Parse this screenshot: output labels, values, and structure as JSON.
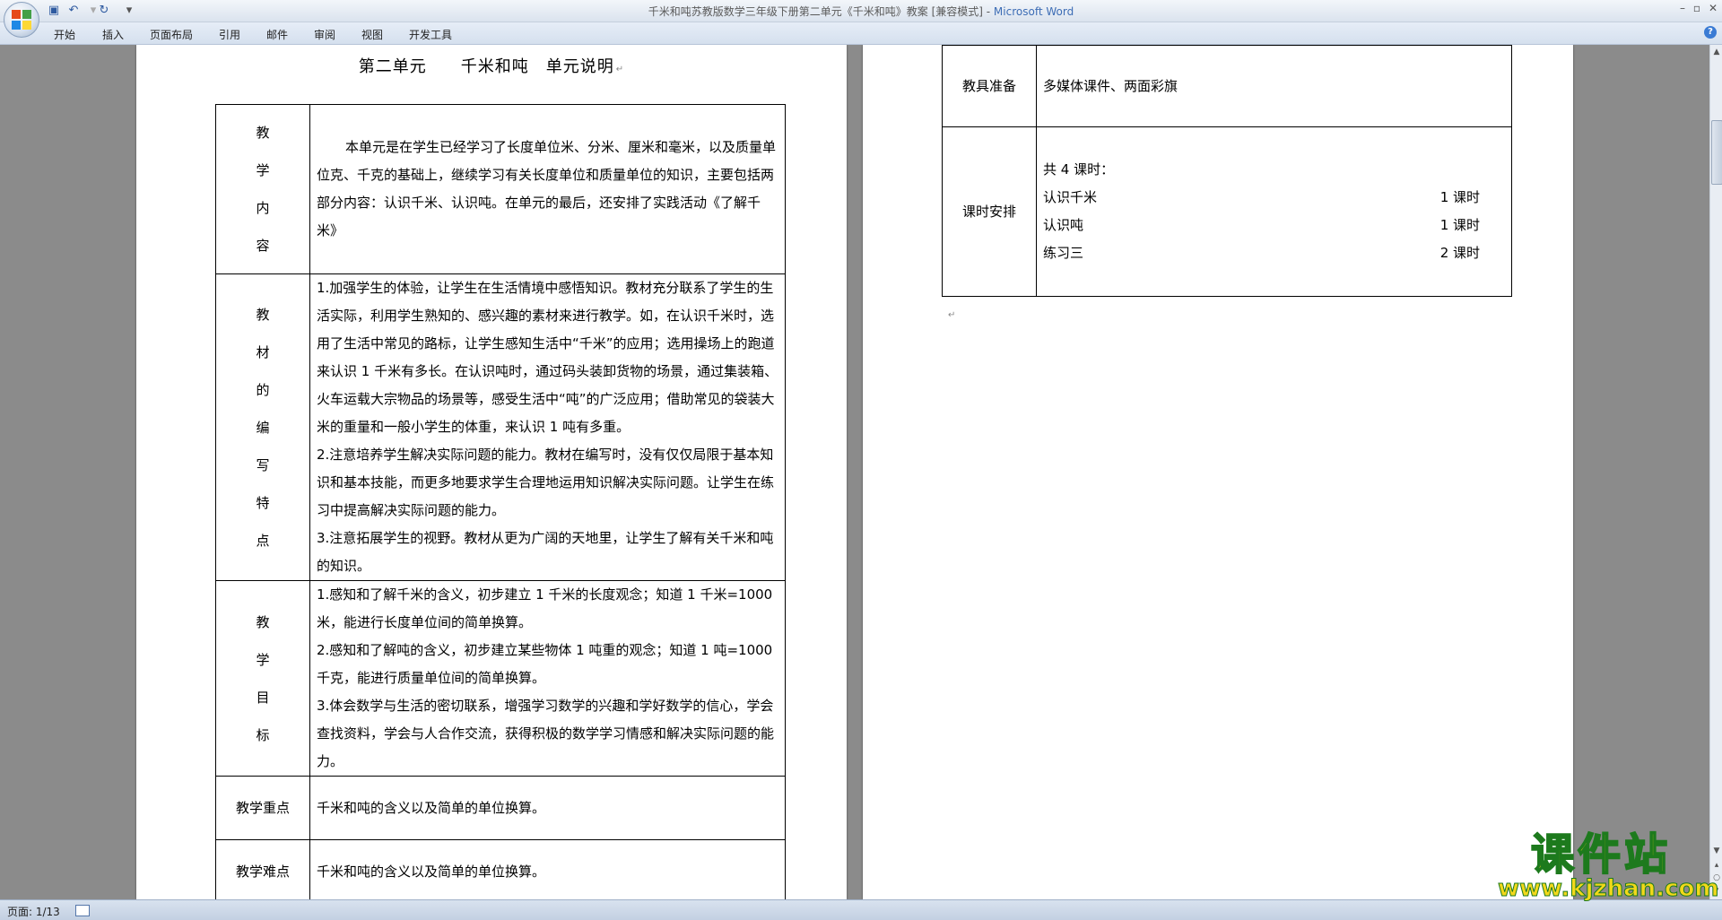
{
  "window": {
    "title": "千米和吨苏教版数学三年级下册第二单元《千米和吨》教案 [兼容模式] - ",
    "app_name": "Microsoft Word"
  },
  "quick_access": {
    "save_icon": "save-icon",
    "undo_icon": "undo-icon",
    "redo_icon": "redo-icon",
    "dropdown": "▾"
  },
  "ribbon": {
    "tabs": [
      "开始",
      "插入",
      "页面布局",
      "引用",
      "邮件",
      "审阅",
      "视图",
      "开发工具"
    ]
  },
  "page1": {
    "title": "第二单元　　千米和吨　单元说明",
    "rows": {
      "content_label": [
        "教",
        "学",
        "内",
        "容"
      ],
      "content_text": "本单元是在学生已经学习了长度单位米、分米、厘米和毫米，以及质量单位克、千克的基础上，继续学习有关长度单位和质量单位的知识，主要包括两部分内容：认识千米、认识吨。在单元的最后，还安排了实践活动《了解千米》",
      "features_label": [
        "教",
        "材",
        "的",
        "编",
        "写",
        "特",
        "点"
      ],
      "features_text": [
        "1.加强学生的体验，让学生在生活情境中感悟知识。教材充分联系了学生的生活实际，利用学生熟知的、感兴趣的素材来进行教学。如，在认识千米时，选用了生活中常见的路标，让学生感知生活中“千米”的应用；选用操场上的跑道来认识 1 千米有多长。在认识吨时，通过码头装卸货物的场景，通过集装箱、火车运载大宗物品的场景等，感受生活中“吨”的广泛应用；借助常见的袋装大米的重量和一般小学生的体重，来认识 1 吨有多重。",
        "2.注意培养学生解决实际问题的能力。教材在编写时，没有仅仅局限于基本知识和基本技能，而更多地要求学生合理地运用知识解决实际问题。让学生在练习中提高解决实际问题的能力。",
        "3.注意拓展学生的视野。教材从更为广阔的天地里，让学生了解有关千米和吨的知识。"
      ],
      "goals_label": [
        "教",
        "学",
        "目",
        "标"
      ],
      "goals_text": [
        "1.感知和了解千米的含义，初步建立 1 千米的长度观念；知道 1 千米=1000 米，能进行长度单位间的简单换算。",
        "2.感知和了解吨的含义，初步建立某些物体 1 吨重的观念；知道 1 吨=1000 千克，能进行质量单位间的简单换算。",
        "3.体会数学与生活的密切联系，增强学习数学的兴趣和学好数学的信心，学会查找资料，学会与人合作交流，获得积极的数学学习情感和解决实际问题的能力。"
      ],
      "key_label": "教学重点",
      "key_text": "千米和吨的含义以及简单的单位换算。",
      "difficulty_label": "教学难点",
      "difficulty_text": "千米和吨的含义以及简单的单位换算。"
    }
  },
  "page2": {
    "prep_label": "教具准备",
    "prep_text": "多媒体课件、两面彩旗",
    "schedule_label": "课时安排",
    "schedule_total": "共 4 课时：",
    "schedule": [
      {
        "name": "认识千米",
        "hours": "1 课时"
      },
      {
        "name": "认识吨",
        "hours": "1 课时"
      },
      {
        "name": "练习三",
        "hours": "2 课时"
      }
    ]
  },
  "status": {
    "page_count": "页面: 1/13"
  },
  "watermark": {
    "main": "课件站",
    "url": "www.kjzhan.com"
  },
  "colors": {
    "accent": "#3d6db5",
    "watermark_fill": "#f2d81a",
    "watermark_stroke": "#1d7a1d"
  }
}
